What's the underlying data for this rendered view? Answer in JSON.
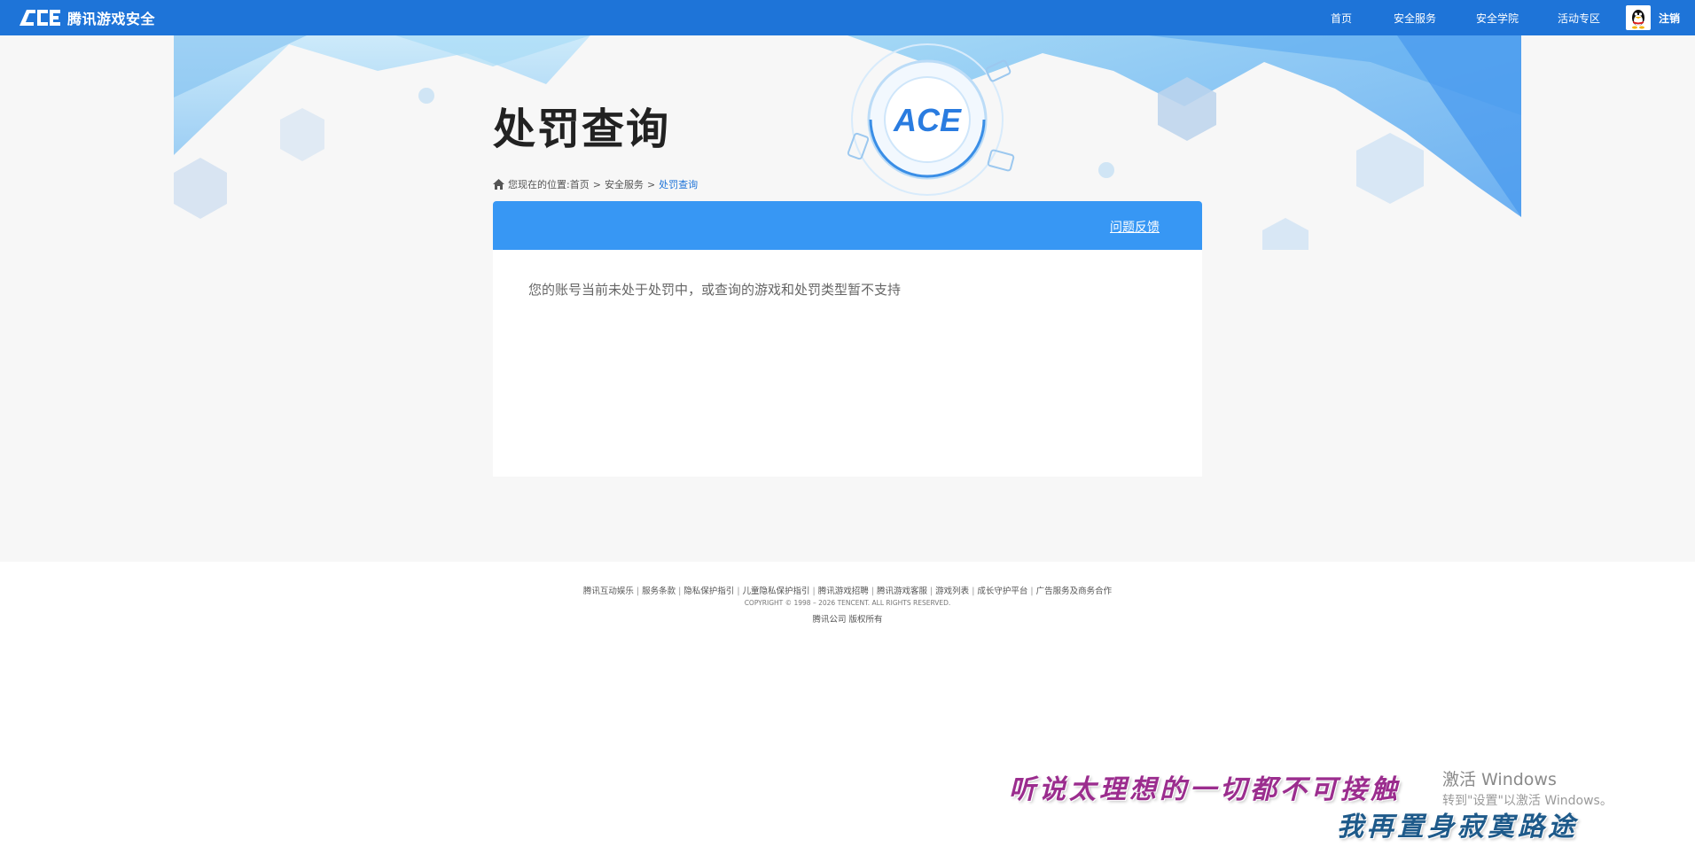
{
  "brand": {
    "logo_text": "腾讯游戏安全",
    "logo_mark": "ACE"
  },
  "nav": {
    "items": [
      "首页",
      "安全服务",
      "安全学院",
      "活动专区"
    ],
    "user_name": "注销"
  },
  "banner": {
    "center_logo": "ACE"
  },
  "page": {
    "title": "处罚查询",
    "breadcrumb": {
      "prefix": "您现在的位置:",
      "items": [
        "首页",
        "安全服务",
        "处罚查询"
      ],
      "separator": ">"
    },
    "feedback_label": "问题反馈",
    "result_message": "您的账号当前未处于处罚中，或查询的游戏和处罚类型暂不支持"
  },
  "footer": {
    "links": [
      "腾讯互动娱乐",
      "服务条款",
      "隐私保护指引",
      "儿童隐私保护指引",
      "腾讯游戏招聘",
      "腾讯游戏客服",
      "游戏列表",
      "成长守护平台",
      "广告服务及商务合作"
    ],
    "copyright": "COPYRIGHT © 1998 – 2026 TENCENT. ALL RIGHTS RESERVED.",
    "owner": "腾讯公司 版权所有"
  },
  "overlay": {
    "lyric_line1": "听说太理想的一切都不可接触",
    "lyric_line2": "我再置身寂寞路途",
    "watermark_title": "激活 Windows",
    "watermark_sub": "转到\"设置\"以激活 Windows。"
  },
  "colors": {
    "nav_bg": "#1e74d8",
    "panel_header": "#3797f4",
    "page_bg": "#f7f7f7",
    "breadcrumb_active": "#1e74d8"
  },
  "icons": [
    "ace-logo-icon",
    "home-icon",
    "qq-avatar-icon"
  ]
}
